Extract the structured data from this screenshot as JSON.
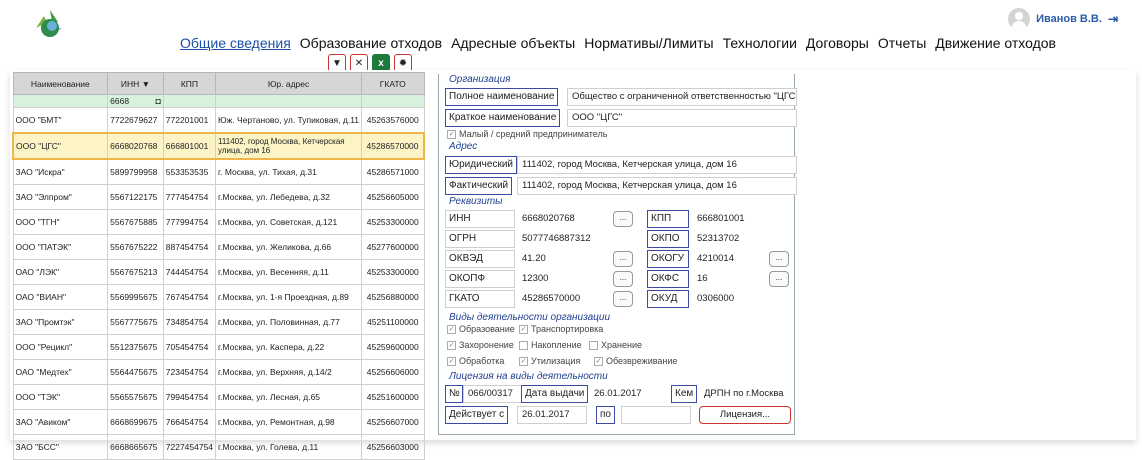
{
  "user": {
    "name": "Иванов В.В."
  },
  "nav": [
    "Общие сведения",
    "Образование отходов",
    "Адресные объекты",
    "Нормативы/Лимиты",
    "Технологии",
    "Договоры",
    "Отчеты",
    "Движение отходов"
  ],
  "toolbar": {
    "excel_label": "x"
  },
  "table": {
    "headers": [
      "Наименование",
      "ИНН ▼",
      "КПП",
      "Юр. адрес",
      "ГКАТО"
    ],
    "filter_inn": "6668",
    "rows": [
      [
        "ООО \"БМТ\"",
        "7722679627",
        "772201001",
        "Юж. Чертаново, ул. Тупиковая, д.11",
        "45263576000"
      ],
      [
        "ООО \"ЦГС\"",
        "6668020768",
        "666801001",
        "111402, город Москва, Кетчерская улица, дом 16",
        "45286570000"
      ],
      [
        "ЗАО \"Искра\"",
        "5899799958",
        "553353535",
        "г. Москва, ул. Тихая, д.31",
        "45286571000"
      ],
      [
        "ЗАО \"Элпром\"",
        "5567122175",
        "777454754",
        "г.Москва, ул. Лебедева, д.32",
        "45256605000"
      ],
      [
        "ООО \"ТГН\"",
        "5567675885",
        "777994754",
        "г.Москва, ул. Советская, д.121",
        "45253300000"
      ],
      [
        "ООО \"ПАТЭК\"",
        "5567675222",
        "887454754",
        "г.Москва, ул. Желикова, д.66",
        "45277600000"
      ],
      [
        "ОАО \"ЛЭК\"",
        "5567675213",
        "744454754",
        "г.Москва, ул. Весенняя, д.11",
        "45253300000"
      ],
      [
        "ОАО \"ВИАН\"",
        "5569995675",
        "767454754",
        "г.Москва, ул. 1-я Проездная, д.89",
        "45256880000"
      ],
      [
        "ЗАО \"Промтэк\"",
        "5567775675",
        "734854754",
        "г.Москва, ул. Половинная, д.77",
        "45251100000"
      ],
      [
        "ООО \"Рецикл\"",
        "5512375675",
        "705454754",
        "г.Москва, ул. Каспера, д.22",
        "45259600000"
      ],
      [
        "ОАО \"Медтех\"",
        "5564475675",
        "723454754",
        "г.Москва, ул. Верхняя, д.14/2",
        "45256606000"
      ],
      [
        "ООО \"ТЭК\"",
        "5565575675",
        "799454754",
        "г.Москва, ул. Лесная, д.65",
        "45251600000"
      ],
      [
        "ЗАО \"Авиком\"",
        "6668699675",
        "766454754",
        "г.Москва, ул. Ремонтная, д.98",
        "45256607000"
      ],
      [
        "ЗАО \"БСС\"",
        "6668665675",
        "7227454754",
        "г.Москва, ул. Голева, д.11",
        "45256603000"
      ]
    ]
  },
  "detail": {
    "org_title": "Организация",
    "full_name_label": "Полное наименование",
    "full_name": "Общество с ограниченной ответственностью \"ЦГС\"",
    "short_name_label": "Краткое наименование",
    "short_name": "ООО \"ЦГС\"",
    "small_business": "Малый / средний предприниматель",
    "addr_title": "Адрес",
    "legal_label": "Юридический",
    "legal": "111402, город Москва, Кетчерская улица, дом 16",
    "actual_label": "Фактический",
    "actual": "111402, город Москва, Кетчерская улица, дом 16",
    "req_title": "Реквизиты",
    "inn_label": "ИНН",
    "inn": "6668020768",
    "kpp_label": "КПП",
    "kpp": "666801001",
    "ogrn_label": "ОГРН",
    "ogrn": "5077746887312",
    "okpo_label": "ОКПО",
    "okpo": "52313702",
    "okved_label": "ОКВЭД",
    "okved": "41.20",
    "okogu_label": "ОКОГУ",
    "okogu": "4210014",
    "okopf_label": "ОКОПФ",
    "okopf": "12300",
    "okfs_label": "ОКФС",
    "okfs": "16",
    "gkato_label": "ГКАТО",
    "gkato": "45286570000",
    "okud_label": "ОКУД",
    "okud": "0306000",
    "dots": "...",
    "activity_title": "Виды деятельности организации",
    "activities": [
      {
        "label": "Образование",
        "checked": true
      },
      {
        "label": "Транспортировка",
        "checked": true
      },
      {
        "label": "Захоронение",
        "checked": true
      },
      {
        "label": "Накопление",
        "checked": false
      },
      {
        "label": "Хранение",
        "checked": false
      },
      {
        "label": "Обработка",
        "checked": true
      },
      {
        "label": "Утилизация",
        "checked": true
      },
      {
        "label": "Обезвреживание",
        "checked": true
      }
    ],
    "license_title": "Лицензия на виды деятельности",
    "num_label": "№",
    "num": "066/00317",
    "issue_label": "Дата выдачи",
    "issue": "26.01.2017",
    "by_label": "Кем",
    "by": "ДРПН по г.Москва",
    "valid_label": "Действует с",
    "valid_from": "26.01.2017",
    "to_label": "по",
    "valid_to": "",
    "license_button": "Лицензия..."
  }
}
